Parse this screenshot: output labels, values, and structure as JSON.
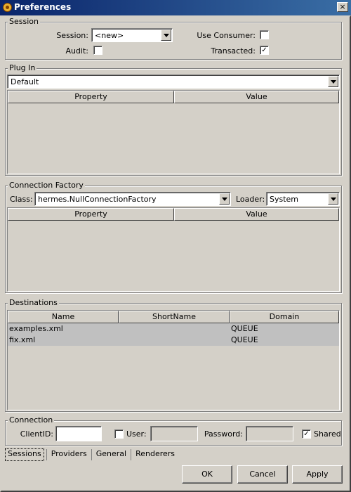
{
  "window": {
    "title": "Preferences",
    "close": "×"
  },
  "session": {
    "legend": "Session",
    "session_label": "Session:",
    "session_value": "<new>",
    "use_consumer_label": "Use Consumer:",
    "use_consumer_checked": false,
    "audit_label": "Audit:",
    "audit_checked": false,
    "transacted_label": "Transacted:",
    "transacted_checked": true
  },
  "plugin": {
    "legend": "Plug In",
    "value": "Default",
    "columns": [
      "Property",
      "Value"
    ]
  },
  "connection_factory": {
    "legend": "Connection Factory",
    "class_label": "Class:",
    "class_value": "hermes.NullConnectionFactory",
    "loader_label": "Loader:",
    "loader_value": "System",
    "columns": [
      "Property",
      "Value"
    ]
  },
  "destinations": {
    "legend": "Destinations",
    "columns": [
      "Name",
      "ShortName",
      "Domain"
    ],
    "rows": [
      {
        "name": "examples.xml",
        "short_name": "",
        "domain": "QUEUE"
      },
      {
        "name": "fix.xml",
        "short_name": "",
        "domain": "QUEUE"
      }
    ]
  },
  "connection": {
    "legend": "Connection",
    "client_id_label": "ClientID:",
    "client_id_value": "",
    "user_label": "User:",
    "user_checked": false,
    "user_value": "",
    "password_label": "Password:",
    "password_value": "",
    "shared_label": "Shared",
    "shared_checked": true
  },
  "tabs": [
    "Sessions",
    "Providers",
    "General",
    "Renderers"
  ],
  "buttons": {
    "ok": "OK",
    "cancel": "Cancel",
    "apply": "Apply"
  },
  "glyphs": {
    "check": "✓"
  }
}
